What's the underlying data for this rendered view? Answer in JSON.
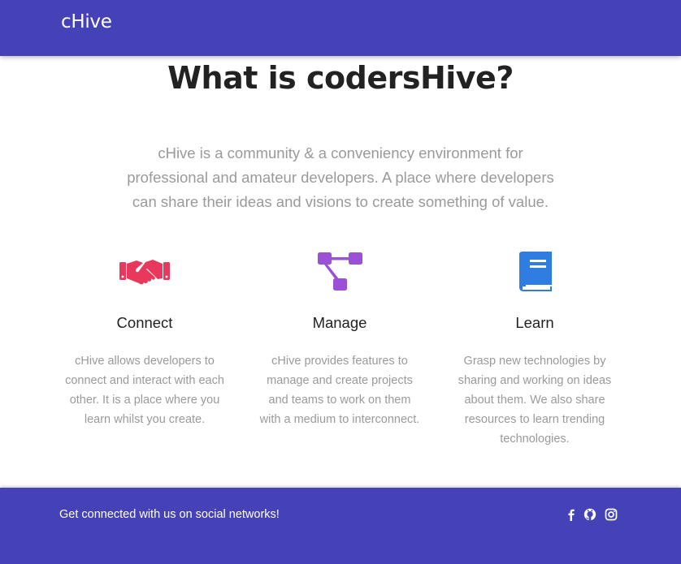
{
  "nav": {
    "brand": "cHive"
  },
  "main": {
    "heading": "What is codersHive?",
    "intro": "cHive is a community & a conveniency environment for professional and amateur developers. A place where developers can share their ideas and visions to create something of value.",
    "features": [
      {
        "title": "Connect",
        "icon": "handshake-icon",
        "color": "#e8395d",
        "text": "cHive allows developers to connect and interact with each other. It is a place where you learn whilst you create."
      },
      {
        "title": "Manage",
        "icon": "project-diagram-icon",
        "color": "#9b51d6",
        "text": "cHive provides features to manage and create projects and teams to work on them with a medium to interconnect."
      },
      {
        "title": "Learn",
        "icon": "book-icon",
        "color": "#2f7de1",
        "text": "Grasp new technologies by sharing and working on ideas about them. We also share resources to learn trending technologies."
      }
    ]
  },
  "footer": {
    "text": "Get connected with us on social networks!",
    "social": [
      "facebook-icon",
      "github-icon",
      "instagram-icon"
    ]
  },
  "colors": {
    "brand": "#4541b7",
    "heading": "#222222",
    "muted": "#9a9a9a"
  }
}
